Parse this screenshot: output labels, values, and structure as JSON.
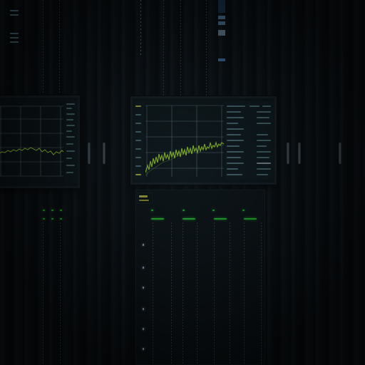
{
  "scene": {
    "description_tags": [
      "server-rack",
      "monitors",
      "waveform"
    ]
  },
  "left_monitor": {
    "panel_rows": 14,
    "waveform_color": "#b7f53a",
    "grid_color": "#6d8a93"
  },
  "center_monitor": {
    "panel_rows": 22,
    "waveform_color": "#b7f53a",
    "grid_color": "#6d8a93",
    "indicator_color": "#d2d84a"
  },
  "colors": {
    "accent_green": "#2eea3c",
    "waveform": "#b7f53a",
    "chassis": "#0b1014",
    "screen_bg": "#0d171b"
  }
}
